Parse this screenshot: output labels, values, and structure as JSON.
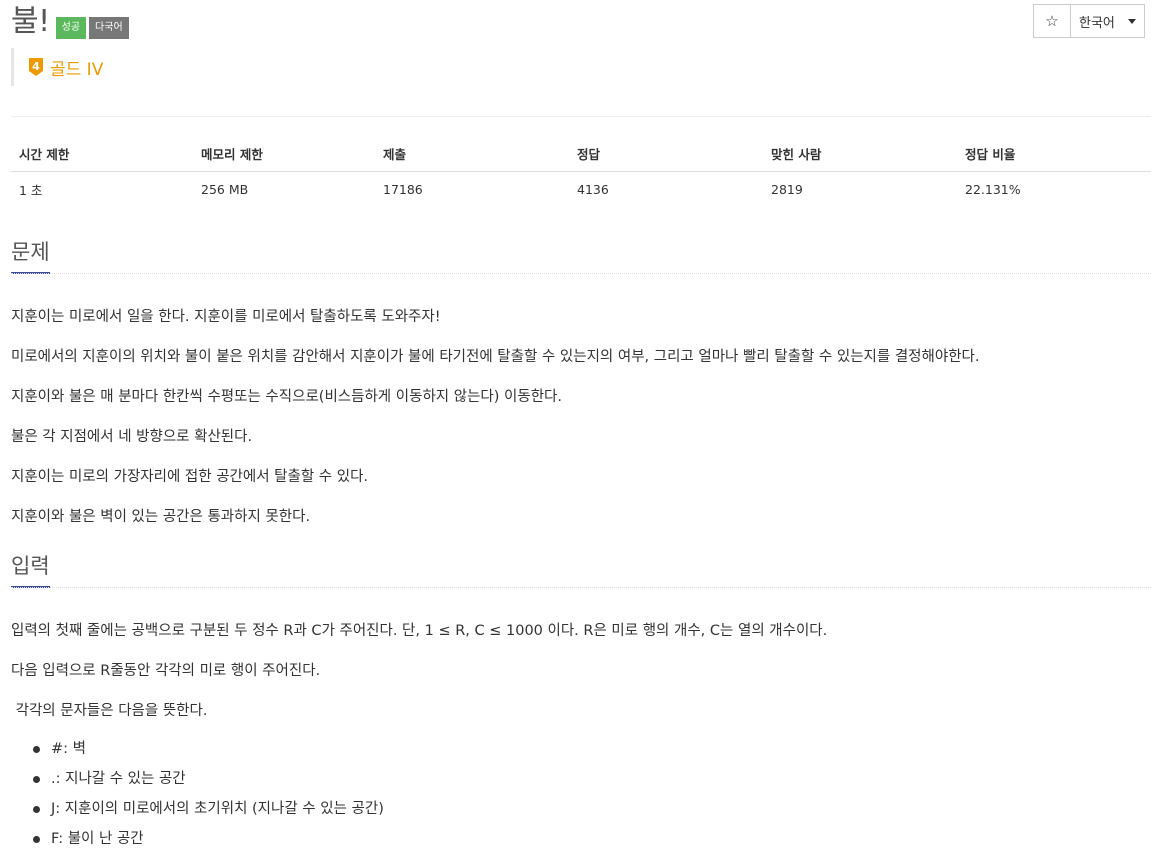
{
  "problem": {
    "title": "불!",
    "labels": [
      {
        "text": "성공",
        "color": "#5cb85c"
      },
      {
        "text": "다국어",
        "color": "#777777"
      }
    ],
    "tier": {
      "badge": "4",
      "text": "골드 IV",
      "color": "#ec9a00"
    }
  },
  "toolbar": {
    "star_icon": "☆",
    "language": "한국어"
  },
  "info": {
    "headers": [
      "시간 제한",
      "메모리 제한",
      "제출",
      "정답",
      "맞힌 사람",
      "정답 비율"
    ],
    "values": [
      "1 초",
      "256 MB",
      "17186",
      "4136",
      "2819",
      "22.131%"
    ]
  },
  "description": {
    "heading": "문제",
    "paragraphs": [
      "지훈이는 미로에서 일을 한다. 지훈이를 미로에서 탈출하도록 도와주자!",
      "미로에서의 지훈이의 위치와 불이 붙은 위치를 감안해서 지훈이가 불에 타기전에 탈출할 수 있는지의 여부, 그리고 얼마나 빨리 탈출할 수 있는지를 결정해야한다.",
      "지훈이와 불은 매 분마다 한칸씩 수평또는 수직으로(비스듬하게 이동하지 않는다)  이동한다.",
      "불은 각 지점에서 네 방향으로 확산된다.",
      "지훈이는 미로의 가장자리에 접한 공간에서 탈출할 수 있다.",
      "지훈이와 불은 벽이 있는 공간은 통과하지 못한다."
    ]
  },
  "input": {
    "heading": "입력",
    "paragraphs": [
      "입력의 첫째 줄에는 공백으로 구분된 두 정수 R과 C가 주어진다. 단, 1 ≤ R, C ≤ 1000 이다. R은 미로 행의 개수, C는 열의 개수이다.",
      "다음 입력으로 R줄동안 각각의 미로 행이 주어진다.",
      " 각각의 문자들은 다음을 뜻한다."
    ],
    "bullets": [
      "#: 벽",
      ".: 지나갈 수 있는 공간",
      "J: 지훈이의 미로에서의 초기위치 (지나갈 수 있는 공간)",
      "F: 불이 난 공간"
    ]
  }
}
